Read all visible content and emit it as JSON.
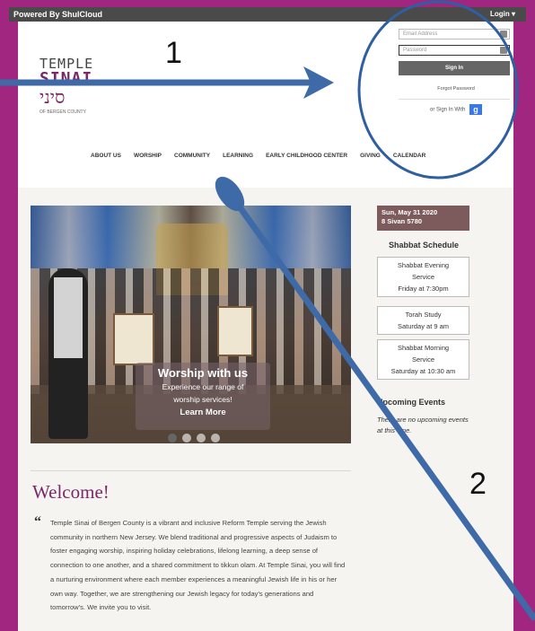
{
  "topbar": {
    "powered_by": "Powered By ShulCloud",
    "login": "Login ▾"
  },
  "logo": {
    "line1": "TEMPLE",
    "line2": "SINAI",
    "line3": "סיני",
    "line4": "OF BERGEN COUNTY"
  },
  "nav": {
    "items": [
      "ABOUT US",
      "WORSHIP",
      "COMMUNITY",
      "LEARNING",
      "EARLY CHILDHOOD CENTER",
      "GIVING",
      "CALENDAR"
    ]
  },
  "login_box": {
    "email_placeholder": "Email Address",
    "password_placeholder": "Password",
    "signin_label": "Sign In",
    "forgot_label": "Forgot Password",
    "or_signin_with": "or Sign In With",
    "google_label": "g"
  },
  "hero": {
    "title": "Worship with us",
    "subtitle_line1": "Experience our range of",
    "subtitle_line2": "worship services!",
    "link": "Learn More",
    "slide_count": 4,
    "active_slide": 1
  },
  "sidebar": {
    "date_line1": "Sun, May 31 2020",
    "date_line2": "8 Sivan 5780",
    "schedule_title": "Shabbat Schedule",
    "schedule": [
      {
        "lines": [
          "Shabbat Evening",
          "Service",
          "Friday at 7:30pm"
        ]
      },
      {
        "lines": [
          "Torah Study",
          "Saturday at 9 am"
        ]
      },
      {
        "lines": [
          "Shabbat Morning",
          "Service",
          "Saturday at 10:30 am"
        ]
      }
    ],
    "events_title": "Upcoming Events",
    "events_text": "There are no upcoming events at this time."
  },
  "welcome": {
    "title": "Welcome!",
    "quote_mark": "“",
    "body": "Temple Sinai of Bergen County is a vibrant and inclusive Reform Temple serving the Jewish community in northern New Jersey. We blend traditional and progressive aspects of Judaism to foster engaging worship, inspiring holiday celebrations, lifelong learning, a deep sense of connection to one another, and a shared commitment to tikkun olam. At Temple Sinai, you will find a nurturing environment where each member experiences a meaningful Jewish life in his or her own way. Together, we are strengthening our Jewish legacy for today's generations and tomorrow's. We invite you to visit."
  },
  "annotations": {
    "label1": "1",
    "label2": "2",
    "color": "#3f6aa8"
  }
}
